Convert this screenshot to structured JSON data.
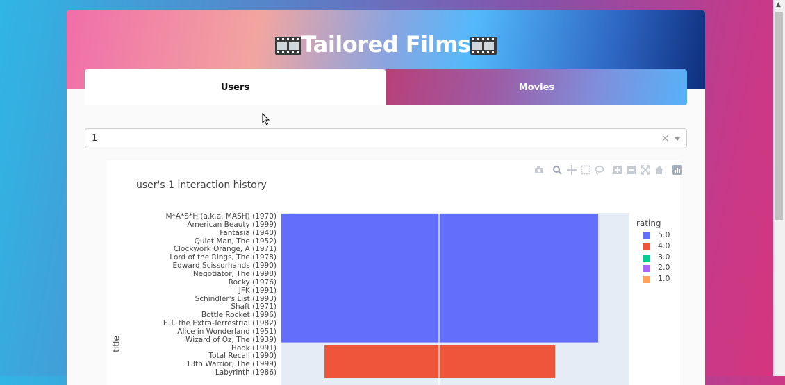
{
  "header": {
    "title": "Tailored Films",
    "icon_left": "film-frames-icon",
    "icon_right": "film-frames-icon"
  },
  "tabs": [
    {
      "label": "Users",
      "selected": true
    },
    {
      "label": "Movies",
      "selected": false
    }
  ],
  "user_select": {
    "value": "1",
    "clear_icon": "×"
  },
  "plot": {
    "modebar_icons": [
      "camera-icon",
      "zoom-icon",
      "pan-icon",
      "box-select-icon",
      "lasso-icon",
      "zoom-in-icon",
      "zoom-out-icon",
      "autoscale-icon",
      "reset-axes-icon",
      "plotly-logo-icon"
    ],
    "ytitle": "title"
  },
  "chart_data": {
    "type": "bar",
    "orientation": "horizontal",
    "title": "user's 1 interaction history",
    "ylabel": "title",
    "categories": [
      "M*A*S*H (a.k.a. MASH) (1970)",
      "American Beauty (1999)",
      "Fantasia (1940)",
      "Quiet Man, The (1952)",
      "Clockwork Orange, A (1971)",
      "Lord of the Rings, The (1978)",
      "Edward Scissorhands (1990)",
      "Negotiator, The (1998)",
      "Rocky (1976)",
      "JFK (1991)",
      "Schindler's List (1993)",
      "Shaft (1971)",
      "Bottle Rocket (1996)",
      "E.T. the Extra-Terrestrial (1982)",
      "Alice in Wonderland (1951)",
      "Wizard of Oz, The (1939)",
      "Hook (1991)",
      "Total Recall (1990)",
      "13th Warrior, The (1999)",
      "Labyrinth (1986)"
    ],
    "ratings": [
      5,
      5,
      5,
      5,
      5,
      5,
      5,
      5,
      5,
      5,
      5,
      5,
      5,
      5,
      5,
      5,
      4,
      4,
      4,
      4
    ],
    "legend": {
      "title": "rating",
      "placement": "right",
      "items": [
        {
          "label": "5.0",
          "color": "#636efa"
        },
        {
          "label": "4.0",
          "color": "#ef553b"
        },
        {
          "label": "3.0",
          "color": "#00cc96"
        },
        {
          "label": "2.0",
          "color": "#ab63fa"
        },
        {
          "label": "1.0",
          "color": "#ffa15a"
        }
      ]
    },
    "grid": true
  }
}
